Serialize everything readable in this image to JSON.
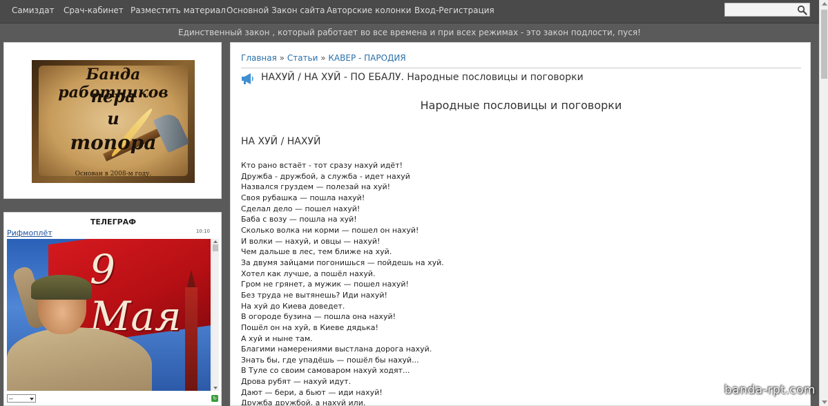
{
  "nav": {
    "items": [
      {
        "label": "Самиздат"
      },
      {
        "label": "Срач-кабинет"
      },
      {
        "label": "Разместить материал"
      },
      {
        "label": "Основной Закон сайта"
      },
      {
        "label": "Авторские колонки"
      },
      {
        "label": "Вход-Регистрация"
      }
    ],
    "search_value": "",
    "search_icon": "search-icon"
  },
  "slogan": "Единственный закон , который работает во все времена и при всех режимах - это закон подлости, пуся!",
  "logo": {
    "line1": "Банда работников",
    "line2": "пера",
    "line3": "и",
    "line4": "топора",
    "subtitle": "Основан в 2008-м году."
  },
  "telegraph": {
    "title": "ТЕЛЕГРАФ",
    "link": "Рифмоплёт",
    "time": "10:10",
    "image_caption": "9 Мая",
    "select_value": "--"
  },
  "breadcrumb": {
    "home": "Главная",
    "sep1": " » ",
    "articles": "Статьи",
    "sep2": " » ",
    "category": "КАВЕР - ПАРОДИЯ"
  },
  "article": {
    "title": "НАХУЙ / НА ХУЙ - ПО ЕБАЛУ. Народные пословицы и поговорки",
    "subtitle": "Народные пословицы и поговорки",
    "section_heading": "НА ХУЙ / НАХУЙ",
    "lines": [
      "Кто рано встаёт - тот сразу нахуй идёт!",
      "Дружба - дружбой, а служба - идет нахуй",
      "Назвался груздем — полезай на хуй!",
      "Своя рубашка — пошла нахуй!",
      "Сделал дело — пошел нахуй!",
      "Баба с возу — пошла на хуй!",
      "Сколько волка ни корми — пошел он нахуй!",
      "И волки — нахуй, и овцы — нахуй!",
      "Чем дальше в лес, тем ближе на хуй.",
      "За двумя зайцами погонишься — пойдешь на хуй.",
      "Хотел как лучше, а пошёл нахуй.",
      "Гром не грянет, а мужик — пошел нахуй!",
      "Без труда не вытянешь? Иди нахуй!",
      "На хуй до Киева доведет.",
      "В огороде бузина — пошла она нахуй!",
      "Пошёл он на хуй, в Киеве дядька!",
      "А хуй и ныне там.",
      "Благими намерениями выстлана дорога нахуй.",
      "Знать бы, где упадёшь — пошёл бы нахуй...",
      "В Туле со своим самоваром нахуй ходят...",
      "Дрова рубят — нахуй идут.",
      "Дают — бери, а бьют — иди нахуй!",
      "Дружба дружбой, а нахуй или."
    ]
  },
  "watermark": "banda-rpt.com",
  "colors": {
    "nav_bg": "#4a4a4a",
    "page_bg": "#5a5a5a",
    "link": "#2a6fa8",
    "text": "#222222"
  }
}
